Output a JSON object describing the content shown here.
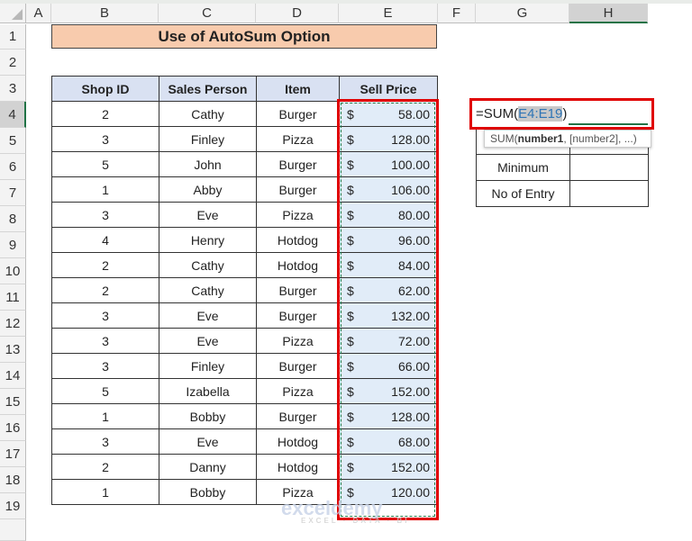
{
  "columns": [
    "A",
    "B",
    "C",
    "D",
    "E",
    "F",
    "G",
    "H"
  ],
  "selected_column": "H",
  "rows": [
    "1",
    "2",
    "3",
    "4",
    "5",
    "6",
    "7",
    "8",
    "9",
    "10",
    "11",
    "12",
    "13",
    "14",
    "15",
    "16",
    "17",
    "18",
    "19"
  ],
  "selected_row": "4",
  "title": "Use of AutoSum Option",
  "table": {
    "headers": [
      "Shop ID",
      "Sales Person",
      "Item",
      "Sell Price"
    ],
    "currency_symbol": "$",
    "rows": [
      {
        "shop_id": "2",
        "person": "Cathy",
        "item": "Burger",
        "price": "58.00"
      },
      {
        "shop_id": "3",
        "person": "Finley",
        "item": "Pizza",
        "price": "128.00"
      },
      {
        "shop_id": "5",
        "person": "John",
        "item": "Burger",
        "price": "100.00"
      },
      {
        "shop_id": "1",
        "person": "Abby",
        "item": "Burger",
        "price": "106.00"
      },
      {
        "shop_id": "3",
        "person": "Eve",
        "item": "Pizza",
        "price": "80.00"
      },
      {
        "shop_id": "4",
        "person": "Henry",
        "item": "Hotdog",
        "price": "96.00"
      },
      {
        "shop_id": "2",
        "person": "Cathy",
        "item": "Hotdog",
        "price": "84.00"
      },
      {
        "shop_id": "2",
        "person": "Cathy",
        "item": "Burger",
        "price": "62.00"
      },
      {
        "shop_id": "3",
        "person": "Eve",
        "item": "Burger",
        "price": "132.00"
      },
      {
        "shop_id": "3",
        "person": "Eve",
        "item": "Pizza",
        "price": "72.00"
      },
      {
        "shop_id": "3",
        "person": "Finley",
        "item": "Burger",
        "price": "66.00"
      },
      {
        "shop_id": "5",
        "person": "Izabella",
        "item": "Pizza",
        "price": "152.00"
      },
      {
        "shop_id": "1",
        "person": "Bobby",
        "item": "Burger",
        "price": "128.00"
      },
      {
        "shop_id": "3",
        "person": "Eve",
        "item": "Hotdog",
        "price": "68.00"
      },
      {
        "shop_id": "2",
        "person": "Danny",
        "item": "Hotdog",
        "price": "152.00"
      },
      {
        "shop_id": "1",
        "person": "Bobby",
        "item": "Pizza",
        "price": "120.00"
      }
    ]
  },
  "side_table": {
    "labels": [
      "Minimum",
      "No of Entry"
    ]
  },
  "formula": {
    "prefix": "=SUM(",
    "range": "E4:E19",
    "suffix": ")"
  },
  "tooltip": {
    "fn": "SUM(",
    "arg1": "number1",
    "rest": ", [number2], ...)"
  },
  "watermark": {
    "brand": "exceldemy",
    "tagline": "EXCEL · DATA · BI"
  },
  "colors": {
    "title_bg": "#f8cbad",
    "header_bg": "#d9e1f2",
    "price_bg": "#e1ecf8",
    "highlight": "#e00000",
    "excel_green": "#217346"
  }
}
